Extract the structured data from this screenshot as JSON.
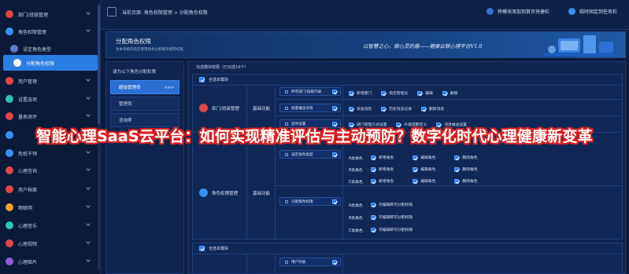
{
  "sidebar": {
    "items": [
      {
        "label": "部门/班级管理",
        "icon": "org-icon",
        "color": "#e24545"
      },
      {
        "label": "角色权限管理",
        "icon": "role-icon",
        "color": "#3a8ff0"
      },
      {
        "label": "设定角色类型",
        "icon": "user-type-icon",
        "color": "#5d79c8"
      },
      {
        "label": "分配角色权限",
        "icon": "assign-icon",
        "color": "#ffffff"
      },
      {
        "label": "用户管理",
        "icon": "user-icon",
        "color": "#e24545"
      },
      {
        "label": "设置选项",
        "icon": "settings-icon",
        "color": "#2fc3b8"
      },
      {
        "label": "量表测评",
        "icon": "scale-icon",
        "color": "#e24545"
      },
      {
        "label": "",
        "icon": "",
        "color": "#3a8ff0"
      },
      {
        "label": "危机干预",
        "icon": "crisis-icon",
        "color": "#3a8ff0"
      },
      {
        "label": "心理咨询",
        "icon": "consult-icon",
        "color": "#e24545"
      },
      {
        "label": "用户档案",
        "icon": "archive-icon",
        "color": "#e24545"
      },
      {
        "label": "物联网",
        "icon": "iot-icon",
        "color": "#f2a32b"
      },
      {
        "label": "心理音乐",
        "icon": "music-icon",
        "color": "#2fc3b8"
      },
      {
        "label": "心理视频",
        "icon": "video-icon",
        "color": "#e24545"
      },
      {
        "label": "心理图片",
        "icon": "image-icon",
        "color": "#8e5bd6"
      }
    ]
  },
  "topbar": {
    "breadcrumb": "当前页面: 角色权限管理 > 分配角色权限",
    "btn_desktop": "将模块添加到首页快捷栏",
    "btn_taskbar": "临时固定到任务栏"
  },
  "banner": {
    "title": "分配角色权限",
    "subtitle": "为本系统的指定使用角色分配模块使用权限。",
    "slogan": "以智慧之心，做心灵的盾——健康云联心理平台V1.0"
  },
  "roles": {
    "header": "请为以下角色分配权限",
    "items": [
      "超级管理员",
      "管理员",
      "咨询师"
    ],
    "active_arrow": ">>>"
  },
  "perm": {
    "header": "勾选模块权限（已勾选19个）",
    "select_all": "全选本模块",
    "block1": {
      "modules": [
        {
          "name": "部门/班级管理",
          "fn": "基础功能"
        },
        {
          "name": "角色权限管理",
          "fn": "基础功能"
        }
      ],
      "pills": [
        "所有部门/班级列表",
        "批量推送消息",
        "选项设置",
        "设定角色类型",
        "分配角色权限"
      ],
      "r1": [
        "新增部门",
        "指定管理员",
        "编辑",
        "删除"
      ],
      "r2": [
        "发送消息",
        "历史消息记录",
        "删除消息"
      ],
      "r3": [
        "部门管理方式设置",
        "升级提醒定义",
        "消息推送设置"
      ],
      "type_rows": [
        {
          "tag": "A类角色",
          "items": [
            "新增角色",
            "编辑角色",
            "删除角色"
          ]
        },
        {
          "tag": "B类角色",
          "items": [
            "新增角色",
            "编辑角色",
            "删除角色"
          ]
        },
        {
          "tag": "C类角色",
          "items": [
            "新增角色",
            "编辑角色",
            "删除角色"
          ]
        }
      ],
      "assign_rows": [
        {
          "tag": "A类角色",
          "item": "可编辑即可分配权限"
        },
        {
          "tag": "B类角色",
          "item": "可编辑即可分配权限"
        },
        {
          "tag": "C类角色",
          "item": "可编辑即可分配权限"
        }
      ]
    },
    "block2": {
      "pill": "用户列表"
    }
  },
  "overlay": "智能心理SaaS云平台：如何实现精准评估与主动预防？数字化时代心理健康新变革",
  "colors": {
    "accent": "#2a7de1",
    "bg": "#0b1d3e",
    "overlay_stroke": "#d92222"
  }
}
